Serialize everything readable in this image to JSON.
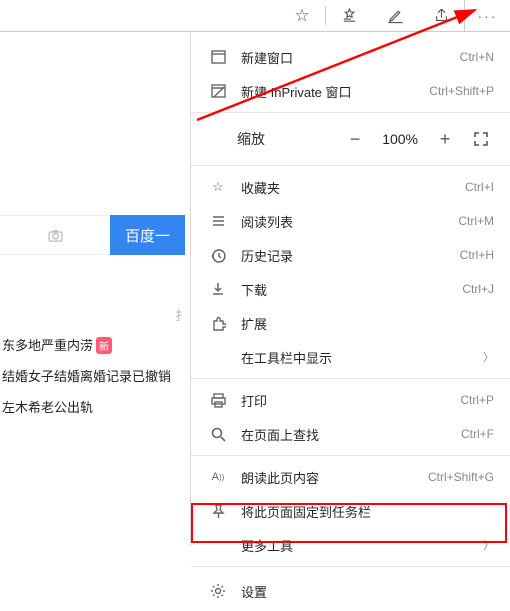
{
  "toolbar": {
    "favorite_tip": "添加到收藏夹",
    "reading_tip": "阅读列表",
    "notes_tip": "笔记",
    "share_tip": "分享",
    "menu_tip": "设置及更多"
  },
  "background": {
    "search_btn": "百度一",
    "refresh_hint": "扌",
    "news": [
      {
        "text": "东多地严重内涝",
        "badge": "新"
      },
      {
        "text": "结婚女子结婚离婚记录已撤销",
        "badge": ""
      },
      {
        "text": "左木希老公出轨",
        "badge": ""
      }
    ]
  },
  "menu": {
    "new_window": {
      "label": "新建窗口",
      "shortcut": "Ctrl+N"
    },
    "new_inprivate": {
      "label": "新建 InPrivate 窗口",
      "shortcut": "Ctrl+Shift+P"
    },
    "zoom": {
      "label": "缩放",
      "value": "100%"
    },
    "favorites": {
      "label": "收藏夹",
      "shortcut": "Ctrl+I"
    },
    "reading_list": {
      "label": "阅读列表",
      "shortcut": "Ctrl+M"
    },
    "history": {
      "label": "历史记录",
      "shortcut": "Ctrl+H"
    },
    "downloads": {
      "label": "下载",
      "shortcut": "Ctrl+J"
    },
    "extensions": {
      "label": "扩展"
    },
    "show_in_toolbar": {
      "label": "在工具栏中显示"
    },
    "print": {
      "label": "打印",
      "shortcut": "Ctrl+P"
    },
    "find": {
      "label": "在页面上查找",
      "shortcut": "Ctrl+F"
    },
    "read_aloud": {
      "label": "朗读此页内容",
      "shortcut": "Ctrl+Shift+G"
    },
    "pin_taskbar": {
      "label": "将此页面固定到任务栏"
    },
    "more_tools": {
      "label": "更多工具"
    },
    "settings": {
      "label": "设置"
    }
  }
}
